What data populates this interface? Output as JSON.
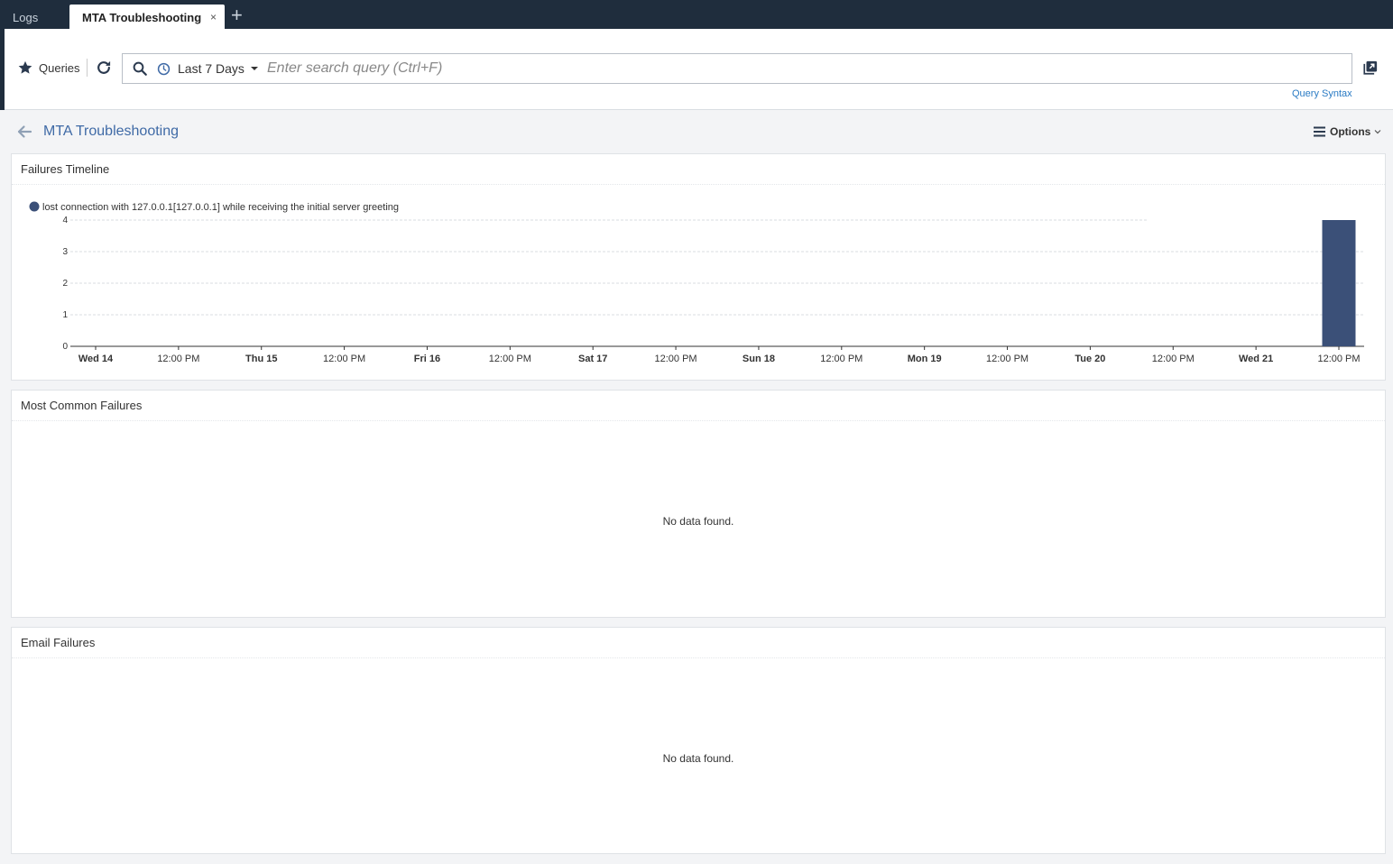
{
  "tabs": {
    "logs_label": "Logs",
    "active_label": "MTA Troubleshooting",
    "close_glyph": "×",
    "add_glyph": "+"
  },
  "toolbar": {
    "queries_label": "Queries",
    "time_range_label": "Last 7 Days",
    "search_placeholder": "Enter search query (Ctrl+F)",
    "search_value": "",
    "query_syntax_label": "Query Syntax"
  },
  "header": {
    "title": "MTA Troubleshooting",
    "options_label": "Options"
  },
  "panels": {
    "timeline": {
      "title": "Failures Timeline"
    },
    "common": {
      "title": "Most Common Failures",
      "empty_text": "No data found."
    },
    "email": {
      "title": "Email Failures",
      "empty_text": "No data found."
    }
  },
  "colors": {
    "accent": "#3f6aa6",
    "bar": "#3b5078",
    "tabbar": "#1f2d3d",
    "link": "#2a7bc4"
  },
  "icons": {
    "queries": "star-icon",
    "refresh": "refresh-icon",
    "search": "search-icon",
    "time": "clock-icon",
    "popout": "popout-icon",
    "back": "back-arrow-icon",
    "options": "hamburger-icon"
  },
  "chart_data": {
    "type": "bar",
    "series": [
      {
        "name": "lost connection with 127.0.0.1[127.0.0.1] while receiving the initial server greeting",
        "points": [
          {
            "x": "Wed 21 12:00 PM",
            "y": 4
          }
        ]
      }
    ],
    "x_tick_labels": [
      "Wed 14",
      "12:00 PM",
      "Thu 15",
      "12:00 PM",
      "Fri 16",
      "12:00 PM",
      "Sat 17",
      "12:00 PM",
      "Sun 18",
      "12:00 PM",
      "Mon 19",
      "12:00 PM",
      "Tue 20",
      "12:00 PM",
      "Wed 21",
      "12:00 PM"
    ],
    "x_tick_bold": [
      true,
      false,
      true,
      false,
      true,
      false,
      true,
      false,
      true,
      false,
      true,
      false,
      true,
      false,
      true,
      false
    ],
    "y_ticks": [
      0,
      1,
      2,
      3,
      4
    ],
    "ylim": [
      0,
      4
    ],
    "grid": true,
    "legend_position": "top-left",
    "title": "",
    "xlabel": "",
    "ylabel": ""
  }
}
